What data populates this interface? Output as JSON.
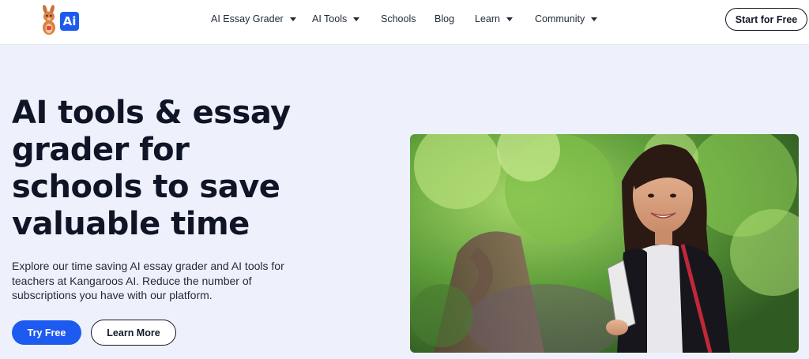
{
  "brand": {
    "logo_text": "Ai",
    "accent": "#1d5bf0"
  },
  "nav": {
    "items": [
      {
        "label": "AI Essay Grader",
        "has_dropdown": true
      },
      {
        "label": "AI Tools",
        "has_dropdown": true
      },
      {
        "label": "Schools",
        "has_dropdown": false
      },
      {
        "label": "Blog",
        "has_dropdown": false
      },
      {
        "label": "Learn",
        "has_dropdown": true
      },
      {
        "label": "Community",
        "has_dropdown": true
      }
    ],
    "cta": "Start for Free"
  },
  "hero": {
    "title_lines": [
      "AI tools & essay",
      "grader for",
      "schools to save",
      "valuable time"
    ],
    "description": "Explore our time saving AI essay grader and AI tools for teachers at Kangaroos AI. Reduce the number of subscriptions you have with our platform.",
    "primary_button": "Try Free",
    "secondary_button": "Learn More"
  }
}
